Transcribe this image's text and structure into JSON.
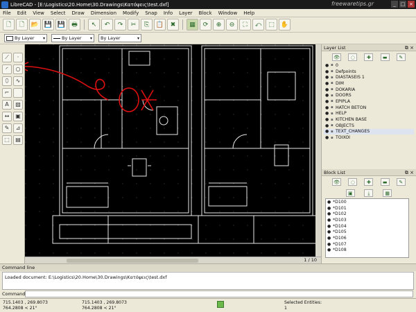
{
  "window": {
    "title": "LibreCAD - [E:\\Logistics\\20.Home\\30.Drawings\\Κατόψεις\\test.dxf]",
    "watermark": "freewaretips.gr",
    "controls": [
      "_",
      "□",
      "×"
    ]
  },
  "menu": [
    "File",
    "Edit",
    "View",
    "Select",
    "Draw",
    "Dimension",
    "Modify",
    "Snap",
    "Info",
    "Layer",
    "Block",
    "Window",
    "Help"
  ],
  "pen_toolbar": {
    "color": "By Layer",
    "width": "By Layer",
    "type": "By Layer"
  },
  "canvas": {
    "page_indicator": "1 / 10"
  },
  "layer_list": {
    "title": "Layer List",
    "layers": [
      "0",
      "Defpoints",
      "DIASTASEIS 1",
      "DIM",
      "DOKARIA",
      "DOORS",
      "EPIPLA",
      "HATCH BETON",
      "HELP",
      "KITCHEN BASE",
      "OBJECTS",
      "TEXT_CHANGES",
      "TOIXOI"
    ],
    "selected": "TEXT_CHANGES"
  },
  "block_list": {
    "title": "Block List",
    "blocks": [
      "*D100",
      "*D101",
      "*D102",
      "*D103",
      "*D104",
      "*D105",
      "*D106",
      "*D107",
      "*D108"
    ]
  },
  "command_line": {
    "title": "Command line",
    "output": "Loaded document: E:\\Logistics\\20.Home\\30.Drawings\\Κατόψεις\\test.dxf",
    "prompt": "Command:"
  },
  "status": {
    "abs_coord_1": "715.1403 , 269.8073",
    "abs_coord_2": "764.2808 < 21°",
    "rel_coord_1": "715.1403 , 269.8073",
    "rel_coord_2": "764.2808 < 21°",
    "selected_label": "Selected Entities:",
    "selected_count": "1"
  },
  "colors": {
    "canvas_bg": "#000000",
    "annotation": "#e01010",
    "titlebar": "#1a1a1a"
  }
}
